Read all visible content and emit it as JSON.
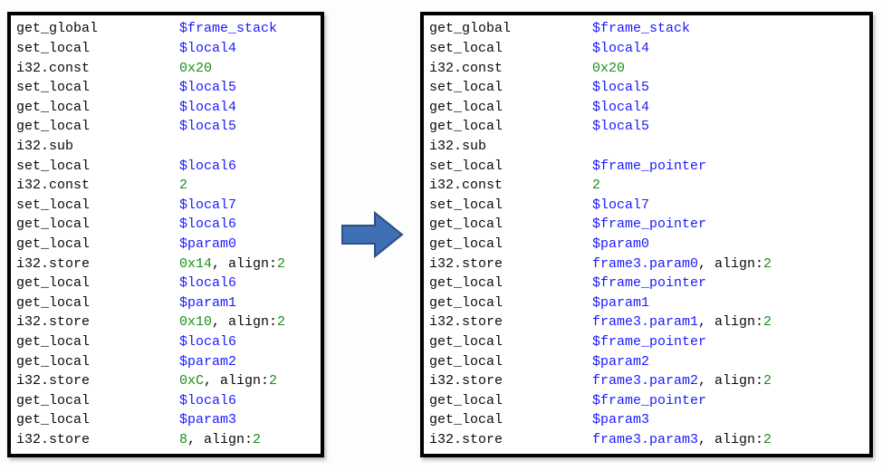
{
  "arrow": {
    "fill": "#3f6fb5",
    "stroke": "#2c4f85"
  },
  "left": {
    "lines": [
      {
        "op": "get_global",
        "args": [
          {
            "t": "var",
            "v": "$frame_stack"
          }
        ]
      },
      {
        "op": "set_local",
        "args": [
          {
            "t": "var",
            "v": "$local4"
          }
        ]
      },
      {
        "op": "i32.const",
        "args": [
          {
            "t": "num",
            "v": "0x20"
          }
        ]
      },
      {
        "op": "set_local",
        "args": [
          {
            "t": "var",
            "v": "$local5"
          }
        ]
      },
      {
        "op": "get_local",
        "args": [
          {
            "t": "var",
            "v": "$local4"
          }
        ]
      },
      {
        "op": "get_local",
        "args": [
          {
            "t": "var",
            "v": "$local5"
          }
        ]
      },
      {
        "op": "i32.sub",
        "args": []
      },
      {
        "op": "set_local",
        "args": [
          {
            "t": "var",
            "v": "$local6"
          }
        ]
      },
      {
        "op": "i32.const",
        "args": [
          {
            "t": "num",
            "v": "2"
          }
        ]
      },
      {
        "op": "set_local",
        "args": [
          {
            "t": "var",
            "v": "$local7"
          }
        ]
      },
      {
        "op": "get_local",
        "args": [
          {
            "t": "var",
            "v": "$local6"
          }
        ]
      },
      {
        "op": "get_local",
        "args": [
          {
            "t": "var",
            "v": "$param0"
          }
        ]
      },
      {
        "op": "i32.store",
        "args": [
          {
            "t": "num",
            "v": "0x14"
          },
          {
            "t": "plain",
            "v": ", align:"
          },
          {
            "t": "num",
            "v": "2"
          }
        ]
      },
      {
        "op": "get_local",
        "args": [
          {
            "t": "var",
            "v": "$local6"
          }
        ]
      },
      {
        "op": "get_local",
        "args": [
          {
            "t": "var",
            "v": "$param1"
          }
        ]
      },
      {
        "op": "i32.store",
        "args": [
          {
            "t": "num",
            "v": "0x10"
          },
          {
            "t": "plain",
            "v": ", align:"
          },
          {
            "t": "num",
            "v": "2"
          }
        ]
      },
      {
        "op": "get_local",
        "args": [
          {
            "t": "var",
            "v": "$local6"
          }
        ]
      },
      {
        "op": "get_local",
        "args": [
          {
            "t": "var",
            "v": "$param2"
          }
        ]
      },
      {
        "op": "i32.store",
        "args": [
          {
            "t": "num",
            "v": "0xC"
          },
          {
            "t": "plain",
            "v": ", align:"
          },
          {
            "t": "num",
            "v": "2"
          }
        ]
      },
      {
        "op": "get_local",
        "args": [
          {
            "t": "var",
            "v": "$local6"
          }
        ]
      },
      {
        "op": "get_local",
        "args": [
          {
            "t": "var",
            "v": "$param3"
          }
        ]
      },
      {
        "op": "i32.store",
        "args": [
          {
            "t": "num",
            "v": "8"
          },
          {
            "t": "plain",
            "v": ", align:"
          },
          {
            "t": "num",
            "v": "2"
          }
        ]
      }
    ]
  },
  "right": {
    "lines": [
      {
        "op": "get_global",
        "args": [
          {
            "t": "var",
            "v": "$frame_stack"
          }
        ]
      },
      {
        "op": "set_local",
        "args": [
          {
            "t": "var",
            "v": "$local4"
          }
        ]
      },
      {
        "op": "i32.const",
        "args": [
          {
            "t": "num",
            "v": "0x20"
          }
        ]
      },
      {
        "op": "set_local",
        "args": [
          {
            "t": "var",
            "v": "$local5"
          }
        ]
      },
      {
        "op": "get_local",
        "args": [
          {
            "t": "var",
            "v": "$local4"
          }
        ]
      },
      {
        "op": "get_local",
        "args": [
          {
            "t": "var",
            "v": "$local5"
          }
        ]
      },
      {
        "op": "i32.sub",
        "args": []
      },
      {
        "op": "set_local",
        "args": [
          {
            "t": "var",
            "v": "$frame_pointer"
          }
        ]
      },
      {
        "op": "i32.const",
        "args": [
          {
            "t": "num",
            "v": "2"
          }
        ]
      },
      {
        "op": "set_local",
        "args": [
          {
            "t": "var",
            "v": "$local7"
          }
        ]
      },
      {
        "op": "get_local",
        "args": [
          {
            "t": "var",
            "v": "$frame_pointer"
          }
        ]
      },
      {
        "op": "get_local",
        "args": [
          {
            "t": "var",
            "v": "$param0"
          }
        ]
      },
      {
        "op": "i32.store",
        "args": [
          {
            "t": "var",
            "v": "frame3.param0"
          },
          {
            "t": "plain",
            "v": ", align:"
          },
          {
            "t": "num",
            "v": "2"
          }
        ]
      },
      {
        "op": "get_local",
        "args": [
          {
            "t": "var",
            "v": "$frame_pointer"
          }
        ]
      },
      {
        "op": "get_local",
        "args": [
          {
            "t": "var",
            "v": "$param1"
          }
        ]
      },
      {
        "op": "i32.store",
        "args": [
          {
            "t": "var",
            "v": "frame3.param1"
          },
          {
            "t": "plain",
            "v": ", align:"
          },
          {
            "t": "num",
            "v": "2"
          }
        ]
      },
      {
        "op": "get_local",
        "args": [
          {
            "t": "var",
            "v": "$frame_pointer"
          }
        ]
      },
      {
        "op": "get_local",
        "args": [
          {
            "t": "var",
            "v": "$param2"
          }
        ]
      },
      {
        "op": "i32.store",
        "args": [
          {
            "t": "var",
            "v": "frame3.param2"
          },
          {
            "t": "plain",
            "v": ", align:"
          },
          {
            "t": "num",
            "v": "2"
          }
        ]
      },
      {
        "op": "get_local",
        "args": [
          {
            "t": "var",
            "v": "$frame_pointer"
          }
        ]
      },
      {
        "op": "get_local",
        "args": [
          {
            "t": "var",
            "v": "$param3"
          }
        ]
      },
      {
        "op": "i32.store",
        "args": [
          {
            "t": "var",
            "v": "frame3.param3"
          },
          {
            "t": "plain",
            "v": ", align:"
          },
          {
            "t": "num",
            "v": "2"
          }
        ]
      }
    ]
  }
}
